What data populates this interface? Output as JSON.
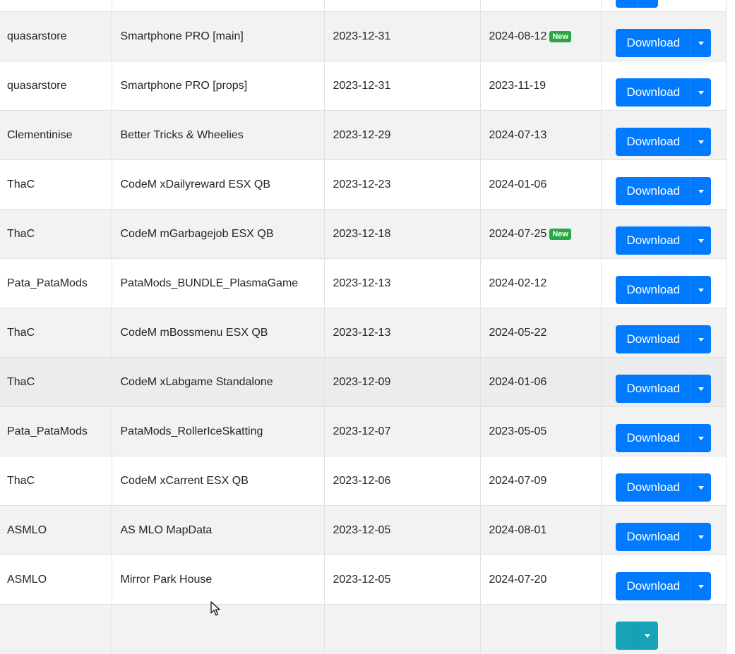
{
  "rows": [
    {
      "author": "",
      "name": "",
      "created": "",
      "updated": "",
      "new": false,
      "download": "",
      "partial": true
    },
    {
      "author": "quasarstore",
      "name": "Smartphone PRO [main]",
      "created": "2023-12-31",
      "updated": "2024-08-12",
      "new": true,
      "download": "Download"
    },
    {
      "author": "quasarstore",
      "name": "Smartphone PRO [props]",
      "created": "2023-12-31",
      "updated": "2023-11-19",
      "new": false,
      "download": "Download"
    },
    {
      "author": "Clementinise",
      "name": "Better Tricks & Wheelies",
      "created": "2023-12-29",
      "updated": "2024-07-13",
      "new": false,
      "download": "Download"
    },
    {
      "author": "ThaC",
      "name": "CodeM xDailyreward ESX QB",
      "created": "2023-12-23",
      "updated": "2024-01-06",
      "new": false,
      "download": "Download"
    },
    {
      "author": "ThaC",
      "name": "CodeM mGarbagejob ESX QB",
      "created": "2023-12-18",
      "updated": "2024-07-25",
      "new": true,
      "download": "Download"
    },
    {
      "author": "Pata_PataMods",
      "name": "PataMods_BUNDLE_PlasmaGame",
      "created": "2023-12-13",
      "updated": "2024-02-12",
      "new": false,
      "download": "Download"
    },
    {
      "author": "ThaC",
      "name": "CodeM mBossmenu ESX QB",
      "created": "2023-12-13",
      "updated": "2024-05-22",
      "new": false,
      "download": "Download"
    },
    {
      "author": "ThaC",
      "name": "CodeM xLabgame Standalone",
      "created": "2023-12-09",
      "updated": "2024-01-06",
      "new": false,
      "download": "Download"
    },
    {
      "author": "Pata_PataMods",
      "name": "PataMods_RollerIceSkatting",
      "created": "2023-12-07",
      "updated": "2023-05-05",
      "new": false,
      "download": "Download"
    },
    {
      "author": "ThaC",
      "name": "CodeM xCarrent ESX QB",
      "created": "2023-12-06",
      "updated": "2024-07-09",
      "new": false,
      "download": "Download"
    },
    {
      "author": "ASMLO",
      "name": "AS MLO MapData",
      "created": "2023-12-05",
      "updated": "2024-08-01",
      "new": false,
      "download": "Download"
    },
    {
      "author": "ASMLO",
      "name": "Mirror Park House",
      "created": "2023-12-05",
      "updated": "2024-07-20",
      "new": false,
      "download": "Download"
    },
    {
      "author": "",
      "name": "",
      "created": "",
      "updated": "",
      "new": false,
      "download": "",
      "partial": true,
      "teal": true
    }
  ],
  "badge_label": "New",
  "icons": {
    "caret": "caret-down-icon",
    "cursor": "mouse-pointer-icon"
  },
  "colors": {
    "primary": "#007bff",
    "badge": "#28a745",
    "stripe": "#f2f2f2",
    "border": "#dee2e6"
  }
}
